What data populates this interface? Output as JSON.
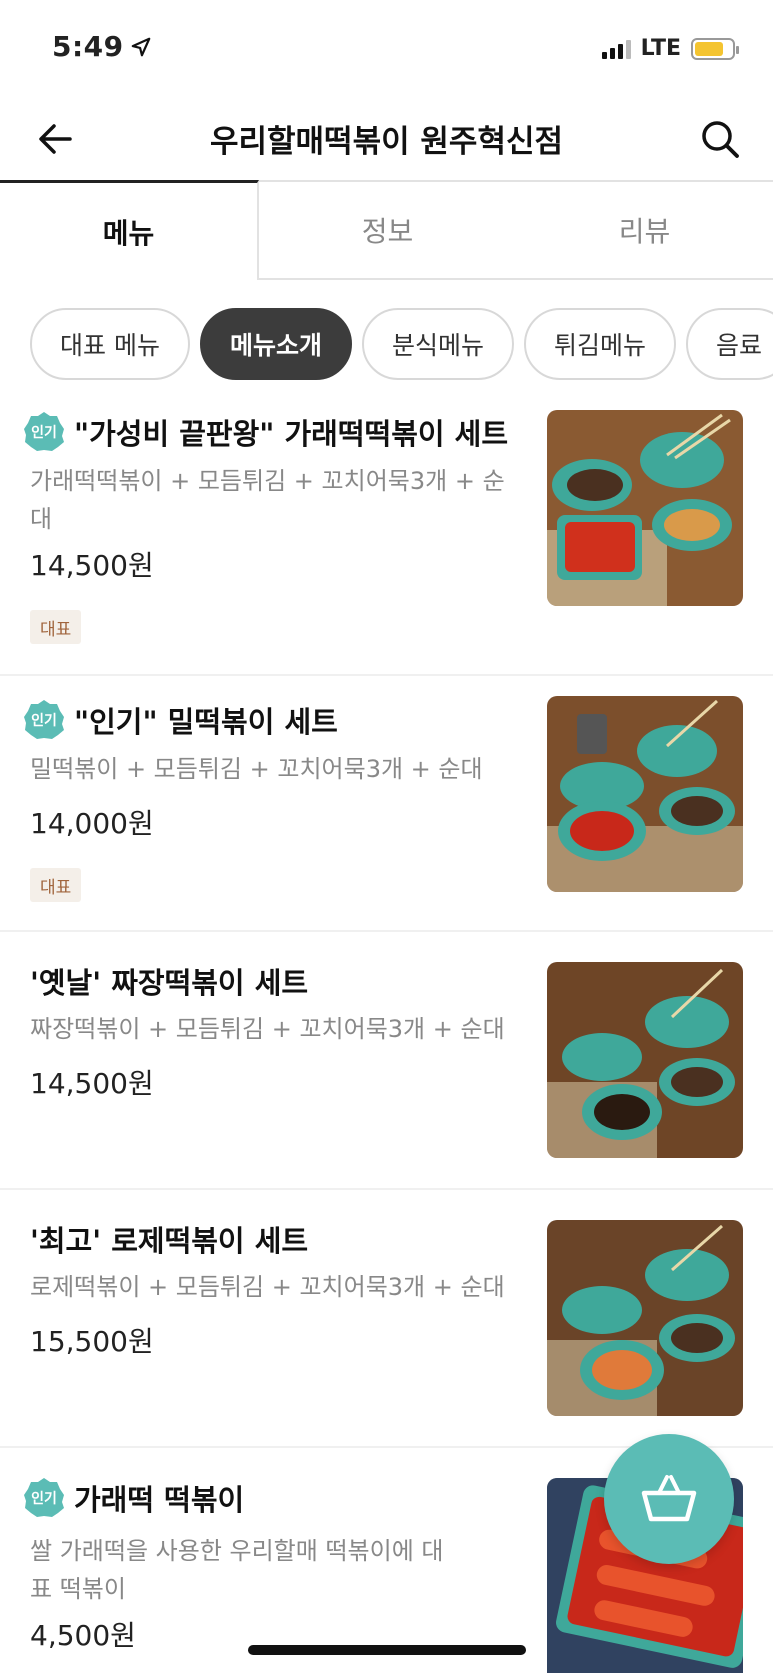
{
  "status_bar": {
    "time": "5:49",
    "network": "LTE"
  },
  "header": {
    "title": "우리할매떡볶이 원주혁신점"
  },
  "tabs": [
    {
      "label": "메뉴",
      "active": true
    },
    {
      "label": "정보",
      "active": false
    },
    {
      "label": "리뷰",
      "active": false
    }
  ],
  "categories": [
    {
      "label": "대표 메뉴",
      "active": false
    },
    {
      "label": "메뉴소개",
      "active": true
    },
    {
      "label": "분식메뉴",
      "active": false
    },
    {
      "label": "튀김메뉴",
      "active": false
    },
    {
      "label": "음료",
      "active": false
    }
  ],
  "popular_badge_label": "인기",
  "menu_items": [
    {
      "name": "\"가성비 끝판왕\" 가래떡떡볶이 세트",
      "desc": "가래떡떡볶이 + 모듬튀김 + 꼬치어묵3개 + 순대",
      "price": "14,500원",
      "popular": true,
      "tag": "대표"
    },
    {
      "name": "\"인기\" 밀떡볶이 세트",
      "desc": "밀떡볶이 + 모듬튀김 + 꼬치어묵3개 + 순대",
      "price": "14,000원",
      "popular": true,
      "tag": "대표"
    },
    {
      "name": "'옛날' 짜장떡볶이 세트",
      "desc": "짜장떡볶이 + 모듬튀김 + 꼬치어묵3개 + 순대",
      "price": "14,500원",
      "popular": false,
      "tag": ""
    },
    {
      "name": "'최고' 로제떡볶이 세트",
      "desc": "로제떡볶이 + 모듬튀김 + 꼬치어묵3개 + 순대",
      "price": "15,500원",
      "popular": false,
      "tag": ""
    },
    {
      "name": "가래떡 떡볶이",
      "desc": "쌀 가래떡을 사용한 우리할매 떡볶이에 대표 떡볶이",
      "price": "4,500원",
      "popular": true,
      "tag": ""
    }
  ],
  "colors": {
    "accent": "#5bbcb5",
    "chip_active": "#3c3c3c",
    "tag_bg": "#f4efe9",
    "tag_text": "#a0643c",
    "battery": "#f4c430"
  }
}
